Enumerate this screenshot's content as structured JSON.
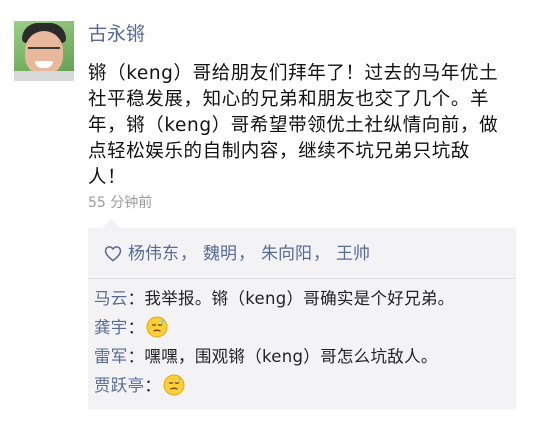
{
  "post": {
    "author": "古永锵",
    "text": "锵（keng）哥给朋友们拜年了！过去的马年优土社平稳发展，知心的兄弟和朋友也交了几个。羊年，锵（keng）哥希望带领优土社纵情向前，做点轻松娱乐的自制内容，继续不坑兄弟只坑敌人！",
    "timestamp": "55 分钟前"
  },
  "likes": {
    "icon": "heart-outline-icon",
    "names": [
      "杨伟东",
      "魏明",
      "朱向阳",
      "王帅"
    ],
    "separator": "，"
  },
  "comments": [
    {
      "name": "马云",
      "colon": "：",
      "text": "我举报。锵（keng）哥确实是个好兄弟。"
    },
    {
      "name": "龚宇",
      "colon": "：",
      "emoji": "sweat-smile-emoji"
    },
    {
      "name": "雷军",
      "colon": "：",
      "text": "嘿嘿，围观锵（keng）哥怎么坑敌人。"
    },
    {
      "name": "贾跃亭",
      "colon": "：",
      "emoji": "sweat-smile-emoji"
    }
  ],
  "colors": {
    "link": "#576b95",
    "panel": "#f3f3f5",
    "timestamp": "#9b9b9b"
  }
}
